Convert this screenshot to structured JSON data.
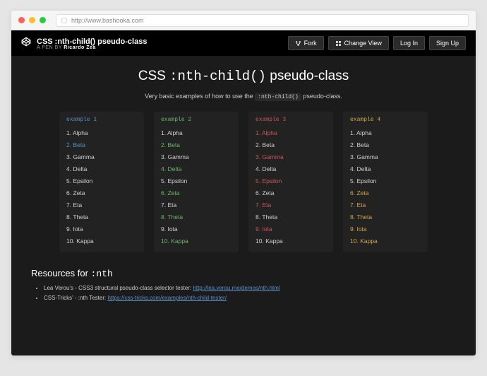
{
  "browser": {
    "url": "http://www.bashooka.com"
  },
  "header": {
    "pen_title": "CSS :nth-child() pseudo-class",
    "pen_by_prefix": "A PEN BY ",
    "pen_author": "Ricardo Zea",
    "actions": {
      "fork": "Fork",
      "change_view": "Change View",
      "login": "Log In",
      "signup": "Sign Up"
    }
  },
  "main": {
    "title_pre": "CSS ",
    "title_code": ":nth-child()",
    "title_post": " pseudo-class",
    "desc_pre": "Very basic examples of how to use the ",
    "desc_code": ":nth-child()",
    "desc_post": " pseudo-class."
  },
  "columns": [
    {
      "title": "example 1",
      "items": [
        "Alpha",
        "Beta",
        "Gamma",
        "Delta",
        "Epsilon",
        "Zeta",
        "Eta",
        "Theta",
        "Iota",
        "Kappa"
      ]
    },
    {
      "title": "example 2",
      "items": [
        "Alpha",
        "Beta",
        "Gamma",
        "Delta",
        "Epsilon",
        "Zeta",
        "Eta",
        "Theta",
        "Iota",
        "Kappa"
      ]
    },
    {
      "title": "example 3",
      "items": [
        "Alpha",
        "Beta",
        "Gamma",
        "Delta",
        "Epsilon",
        "Zeta",
        "Eta",
        "Theta",
        "Iota",
        "Kappa"
      ]
    },
    {
      "title": "example 4",
      "items": [
        "Alpha",
        "Beta",
        "Gamma",
        "Delta",
        "Epsilon",
        "Zeta",
        "Eta",
        "Theta",
        "Iota",
        "Kappa"
      ]
    }
  ],
  "resources": {
    "title_pre": "Resources for ",
    "title_code": ":nth",
    "items": [
      {
        "text": "Lea Verou's - CSS3 structural pseudo-class selector tester: ",
        "link_text": "http://lea.verou.me/demos/nth.html"
      },
      {
        "text": "CSS-Tricks' - :nth Tester: ",
        "link_text": "https://css-tricks.com/examples/nth-child-tester/"
      }
    ]
  }
}
